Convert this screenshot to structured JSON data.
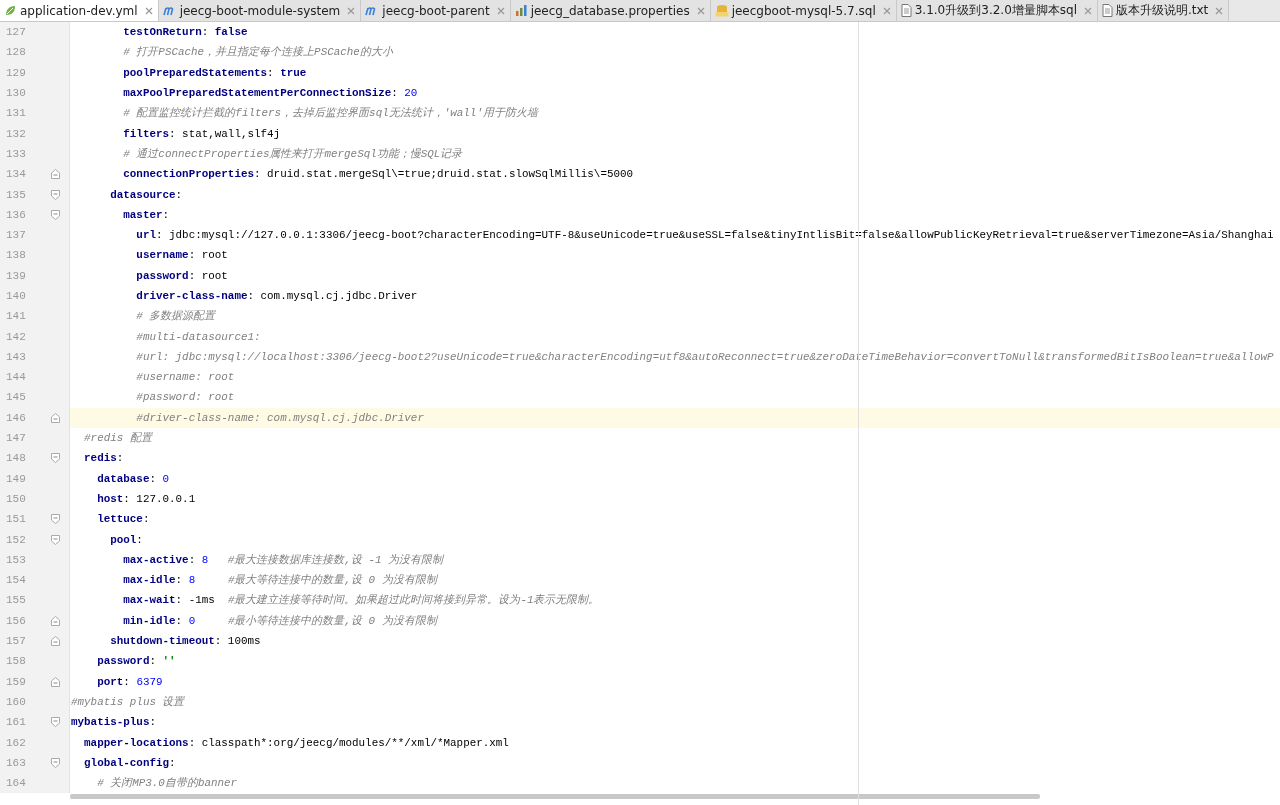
{
  "tabs": [
    {
      "label": "application-dev.yml",
      "kind": "yml",
      "selected": true
    },
    {
      "label": "jeecg-boot-module-system",
      "kind": "maven",
      "selected": false
    },
    {
      "label": "jeecg-boot-parent",
      "kind": "maven",
      "selected": false
    },
    {
      "label": "jeecg_database.properties",
      "kind": "properties",
      "selected": false
    },
    {
      "label": "jeecgboot-mysql-5.7.sql",
      "kind": "sql",
      "selected": false
    },
    {
      "label": "3.1.0升级到3.2.0增量脚本sql",
      "kind": "text",
      "selected": false
    },
    {
      "label": "版本升级说明.txt",
      "kind": "text",
      "selected": false
    }
  ],
  "lines": [
    {
      "number": "127",
      "current": false,
      "tokens": [
        {
          "kind": "key",
          "text": "        testOnReturn"
        },
        {
          "kind": "text",
          "text": ": "
        },
        {
          "kind": "key",
          "text": "false"
        }
      ]
    },
    {
      "number": "128",
      "current": false,
      "tokens": [
        {
          "kind": "comment",
          "text": "        # 打开PSCache，并且指定每个连接上PSCache的大小"
        }
      ]
    },
    {
      "number": "129",
      "current": false,
      "tokens": [
        {
          "kind": "key",
          "text": "        poolPreparedStatements"
        },
        {
          "kind": "text",
          "text": ": "
        },
        {
          "kind": "key",
          "text": "true"
        }
      ]
    },
    {
      "number": "130",
      "current": false,
      "tokens": [
        {
          "kind": "key",
          "text": "        maxPoolPreparedStatementPerConnectionSize"
        },
        {
          "kind": "text",
          "text": ": "
        },
        {
          "kind": "number",
          "text": "20"
        }
      ]
    },
    {
      "number": "131",
      "current": false,
      "tokens": [
        {
          "kind": "comment",
          "text": "        # 配置监控统计拦截的filters，去掉后监控界面sql无法统计，'wall'用于防火墙"
        }
      ]
    },
    {
      "number": "132",
      "current": false,
      "tokens": [
        {
          "kind": "key",
          "text": "        filters"
        },
        {
          "kind": "text",
          "text": ": stat,wall,slf4j"
        }
      ]
    },
    {
      "number": "133",
      "current": false,
      "tokens": [
        {
          "kind": "comment",
          "text": "        # 通过connectProperties属性来打开mergeSql功能；慢SQL记录"
        }
      ]
    },
    {
      "number": "134",
      "current": false,
      "fold_end": true,
      "tokens": [
        {
          "kind": "key",
          "text": "        connectionProperties"
        },
        {
          "kind": "text",
          "text": ": druid.stat.mergeSql\\=true;druid.stat.slowSqlMillis\\=5000"
        }
      ]
    },
    {
      "number": "135",
      "current": false,
      "fold_start": true,
      "tokens": [
        {
          "kind": "key",
          "text": "      datasource"
        },
        {
          "kind": "text",
          "text": ":"
        }
      ]
    },
    {
      "number": "136",
      "current": false,
      "fold_start": true,
      "tokens": [
        {
          "kind": "key",
          "text": "        master"
        },
        {
          "kind": "text",
          "text": ":"
        }
      ]
    },
    {
      "number": "137",
      "current": false,
      "tokens": [
        {
          "kind": "key",
          "text": "          url"
        },
        {
          "kind": "text",
          "text": ": jdbc:mysql://127.0.0.1:3306/jeecg-boot?characterEncoding=UTF-8&useUnicode=true&useSSL=false&tinyIntlisBit=false&allowPublicKeyRetrieval=true&serverTimezone=Asia/Shanghai"
        }
      ]
    },
    {
      "number": "138",
      "current": false,
      "tokens": [
        {
          "kind": "key",
          "text": "          username"
        },
        {
          "kind": "text",
          "text": ": root"
        }
      ]
    },
    {
      "number": "139",
      "current": false,
      "tokens": [
        {
          "kind": "key",
          "text": "          password"
        },
        {
          "kind": "text",
          "text": ": root"
        }
      ]
    },
    {
      "number": "140",
      "current": false,
      "tokens": [
        {
          "kind": "key",
          "text": "          driver-class-name"
        },
        {
          "kind": "text",
          "text": ": com.mysql.cj.jdbc.Driver"
        }
      ]
    },
    {
      "number": "141",
      "current": false,
      "tokens": [
        {
          "kind": "comment",
          "text": "          # 多数据源配置"
        }
      ]
    },
    {
      "number": "142",
      "current": false,
      "tokens": [
        {
          "kind": "comment",
          "text": "          #multi-datasource1:"
        }
      ]
    },
    {
      "number": "143",
      "current": false,
      "tokens": [
        {
          "kind": "comment",
          "text": "          #url: jdbc:mysql://localhost:3306/jeecg-boot2?useUnicode=true&characterEncoding=utf8&autoReconnect=true&zeroDateTimeBehavior=convertToNull&transformedBitIsBoolean=true&allowP"
        }
      ]
    },
    {
      "number": "144",
      "current": false,
      "tokens": [
        {
          "kind": "comment",
          "text": "          #username: root"
        }
      ]
    },
    {
      "number": "145",
      "current": false,
      "tokens": [
        {
          "kind": "comment",
          "text": "          #password: root"
        }
      ]
    },
    {
      "number": "146",
      "current": true,
      "fold_end": true,
      "tokens": [
        {
          "kind": "comment",
          "text": "          #driver-class-name: com.mysql.cj.jdbc.Driver"
        }
      ]
    },
    {
      "number": "147",
      "current": false,
      "tokens": [
        {
          "kind": "comment",
          "text": "  #redis 配置"
        }
      ]
    },
    {
      "number": "148",
      "current": false,
      "fold_start": true,
      "tokens": [
        {
          "kind": "key",
          "text": "  redis"
        },
        {
          "kind": "text",
          "text": ":"
        }
      ]
    },
    {
      "number": "149",
      "current": false,
      "tokens": [
        {
          "kind": "key",
          "text": "    database"
        },
        {
          "kind": "text",
          "text": ": "
        },
        {
          "kind": "number",
          "text": "0"
        }
      ]
    },
    {
      "number": "150",
      "current": false,
      "tokens": [
        {
          "kind": "key",
          "text": "    host"
        },
        {
          "kind": "text",
          "text": ": 127.0.0.1"
        }
      ]
    },
    {
      "number": "151",
      "current": false,
      "fold_start": true,
      "tokens": [
        {
          "kind": "key",
          "text": "    lettuce"
        },
        {
          "kind": "text",
          "text": ":"
        }
      ]
    },
    {
      "number": "152",
      "current": false,
      "fold_start": true,
      "tokens": [
        {
          "kind": "key",
          "text": "      pool"
        },
        {
          "kind": "text",
          "text": ":"
        }
      ]
    },
    {
      "number": "153",
      "current": false,
      "tokens": [
        {
          "kind": "key",
          "text": "        max-active"
        },
        {
          "kind": "text",
          "text": ": "
        },
        {
          "kind": "number",
          "text": "8"
        },
        {
          "kind": "comment",
          "text": "   #最大连接数据库连接数,设 -1 为没有限制"
        }
      ]
    },
    {
      "number": "154",
      "current": false,
      "tokens": [
        {
          "kind": "key",
          "text": "        max-idle"
        },
        {
          "kind": "text",
          "text": ": "
        },
        {
          "kind": "number",
          "text": "8"
        },
        {
          "kind": "comment",
          "text": "     #最大等待连接中的数量,设 0 为没有限制"
        }
      ]
    },
    {
      "number": "155",
      "current": false,
      "tokens": [
        {
          "kind": "key",
          "text": "        max-wait"
        },
        {
          "kind": "text",
          "text": ": -1ms  "
        },
        {
          "kind": "comment",
          "text": "#最大建立连接等待时间。如果超过此时间将接到异常。设为-1表示无限制。"
        }
      ]
    },
    {
      "number": "156",
      "current": false,
      "fold_end": true,
      "tokens": [
        {
          "kind": "key",
          "text": "        min-idle"
        },
        {
          "kind": "text",
          "text": ": "
        },
        {
          "kind": "number",
          "text": "0"
        },
        {
          "kind": "comment",
          "text": "     #最小等待连接中的数量,设 0 为没有限制"
        }
      ]
    },
    {
      "number": "157",
      "current": false,
      "fold_end": true,
      "tokens": [
        {
          "kind": "key",
          "text": "      shutdown-timeout"
        },
        {
          "kind": "text",
          "text": ": 100ms"
        }
      ]
    },
    {
      "number": "158",
      "current": false,
      "tokens": [
        {
          "kind": "key",
          "text": "    password"
        },
        {
          "kind": "text",
          "text": ": "
        },
        {
          "kind": "string",
          "text": "''"
        }
      ]
    },
    {
      "number": "159",
      "current": false,
      "fold_end": true,
      "tokens": [
        {
          "kind": "key",
          "text": "    port"
        },
        {
          "kind": "text",
          "text": ": "
        },
        {
          "kind": "number",
          "text": "6379"
        }
      ]
    },
    {
      "number": "160",
      "current": false,
      "tokens": [
        {
          "kind": "comment",
          "text": "#mybatis plus 设置"
        }
      ]
    },
    {
      "number": "161",
      "current": false,
      "fold_start": true,
      "tokens": [
        {
          "kind": "key",
          "text": "mybatis-plus"
        },
        {
          "kind": "text",
          "text": ":"
        }
      ]
    },
    {
      "number": "162",
      "current": false,
      "tokens": [
        {
          "kind": "key",
          "text": "  mapper-locations"
        },
        {
          "kind": "text",
          "text": ": classpath*:org/jeecg/modules/**/xml/*Mapper.xml"
        }
      ]
    },
    {
      "number": "163",
      "current": false,
      "fold_start": true,
      "tokens": [
        {
          "kind": "key",
          "text": "  global-config"
        },
        {
          "kind": "text",
          "text": ":"
        }
      ]
    },
    {
      "number": "164",
      "current": false,
      "tokens": [
        {
          "kind": "comment",
          "text": "    # 关闭MP3.0自带的banner"
        }
      ]
    }
  ]
}
